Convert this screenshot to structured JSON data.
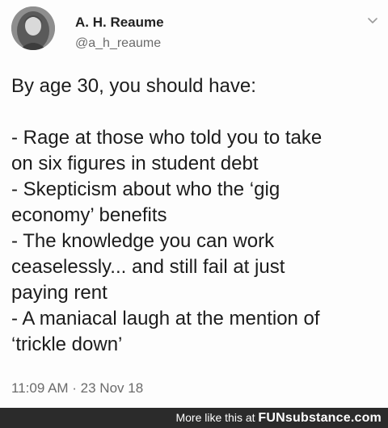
{
  "author": {
    "name": "A. H. Reaume",
    "handle": "@a_h_reaume"
  },
  "tweet": {
    "lines": [
      "By age 30, you should have:",
      "",
      "- Rage at those who told you to take",
      "on six figures in student debt",
      "- Skepticism about who the ‘gig",
      "economy’ benefits",
      "- The knowledge you can work",
      "ceaselessly... and still fail at just",
      "paying rent",
      "- A maniacal laugh at the mention of",
      "‘trickle down’"
    ],
    "timestamp": "11:09 AM · 23 Nov 18"
  },
  "footer": {
    "prefix": "More like this at",
    "brand": "FUNsubstance.com"
  },
  "icons": {
    "menu": "chevron-down-icon",
    "avatar": "avatar"
  },
  "colors": {
    "footer_bg": "#2b2b2b",
    "muted_text": "#6b6b6b",
    "body_text": "#1c1c1c"
  }
}
